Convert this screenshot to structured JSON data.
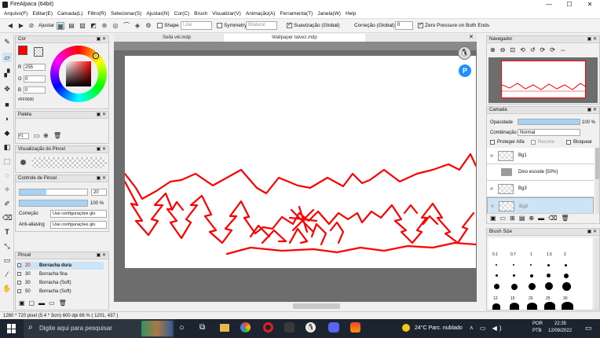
{
  "app": {
    "title": "FireAlpaca (64bit)",
    "min": "—",
    "max": "☐",
    "close": "✕"
  },
  "menu": [
    "Arquivo(F)",
    "Editar(E)",
    "Camada(L)",
    "Filtro(R)",
    "Selecionar(S)",
    "Ajustar(N)",
    "Cor(C)",
    "Brush",
    "Visualizar(V)",
    "Animação(A)",
    "Ferramenta(T)",
    "Janela(W)",
    "Help"
  ],
  "toolbar": {
    "adjust": "Ajustar",
    "shape": "Shape",
    "shape_value": "Line",
    "symmetry": "Symmetry",
    "symmetry_value": "Bilateral",
    "smoothing": "Suavização (Global)",
    "correction": "Correção (Global)",
    "correction_value": "0",
    "zero_pressure": "Zero Pressure on Both Ends"
  },
  "doctabs": [
    "Seilá véi.mdp",
    "Wallpaper talvez.mdp"
  ],
  "color_panel": {
    "title": "Cor",
    "r_label": "R",
    "g_label": "G",
    "b_label": "B",
    "r": "255",
    "g": "0",
    "b": "0",
    "hex": "#FF0000",
    "color": "#ff0000"
  },
  "palette_panel": {
    "title": "Paleta",
    "value": "#1"
  },
  "brush_preview_panel": {
    "title": "Visualização do Pincel"
  },
  "brush_control": {
    "title": "Controle de Pincel",
    "size": "20",
    "opacity": "100 %",
    "correction_label": "Correção",
    "correction_value": "Use configurações glo",
    "antialias_label": "Anti-aliasing",
    "antialias_value": "Use configurações glo"
  },
  "brush_list": {
    "title": "Pincel",
    "items": [
      {
        "size": "20",
        "name": "Borracha dura"
      },
      {
        "size": "30",
        "name": "Borracha fina"
      },
      {
        "size": "30",
        "name": "Borracha (Soft)"
      },
      {
        "size": "50",
        "name": "Borracha (Soft)"
      }
    ]
  },
  "navigator": {
    "title": "Navegador"
  },
  "layers": {
    "title": "Camada",
    "opacity_label": "Opacidade",
    "opacity": "100 %",
    "blend_label": "Combinação",
    "blend": "Normal",
    "protect_alpha": "Proteger Alfa",
    "clipping": "Recorte",
    "lock": "Bloquear",
    "items": [
      "Bg1",
      "Dixo escode [50%]",
      "Bg3",
      "Bg2"
    ]
  },
  "brush_size": {
    "title": "Brush Size",
    "row1": [
      "0.1",
      "0.7",
      "1",
      "1.5",
      "2"
    ],
    "row2": [
      "12",
      "15",
      "20",
      "25",
      "30"
    ]
  },
  "status": "1280 * 720 pixel  (5.4 * 3cm)  600 dpi  66 %  ( 1201, 437 )",
  "taskbar": {
    "search": "Digite aqui para pesquisar",
    "weather": "24°C  Parc. nublado",
    "lang1": "POR",
    "lang2": "PTB",
    "time": "22:35",
    "date": "12/09/2022"
  }
}
